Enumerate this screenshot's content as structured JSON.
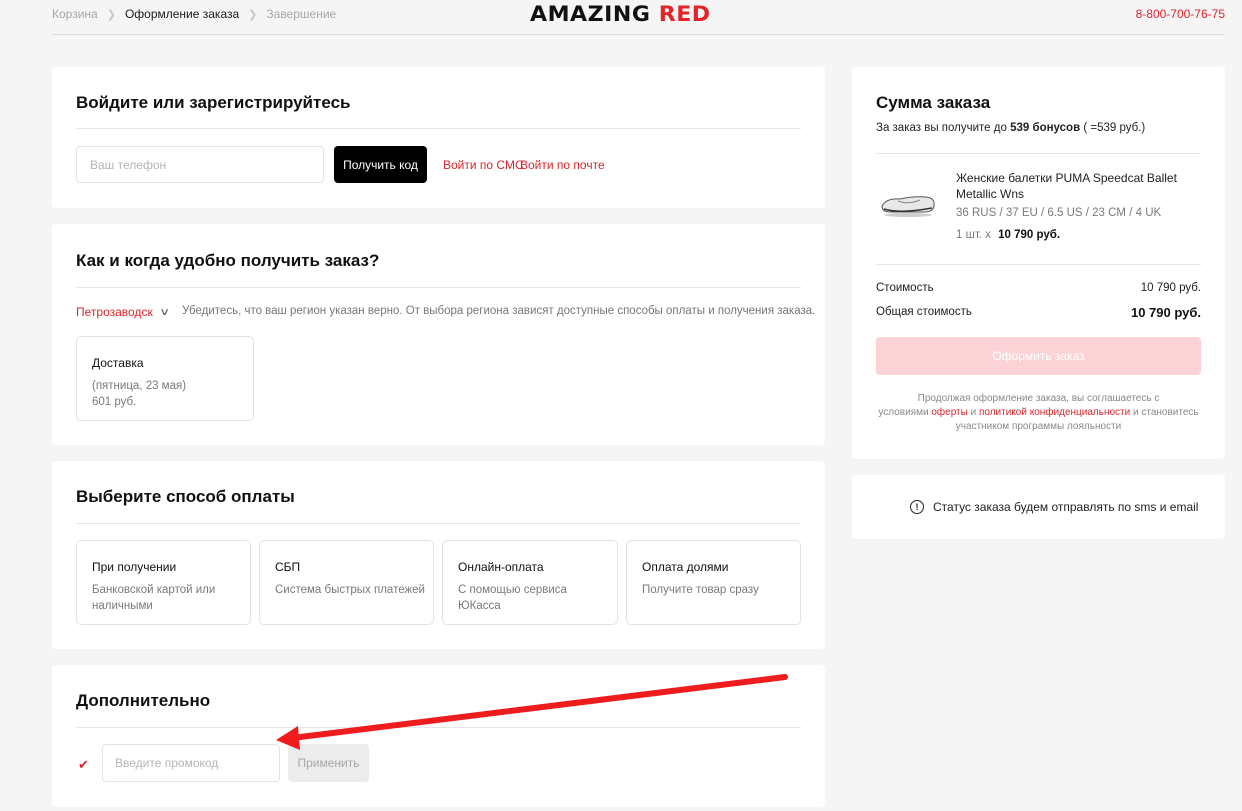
{
  "header": {
    "breadcrumbs": [
      "Корзина",
      "Оформление заказа",
      "Завершение"
    ],
    "logo_part1": "AMAZING",
    "logo_part2": "RED",
    "phone": "8-800-700-76-75"
  },
  "login": {
    "title": "Войдите или зарегистрируйтесь",
    "phone_placeholder": "Ваш телефон",
    "get_code_label": "Получить код",
    "sms_link": "Войти по СМС",
    "email_link": "Войти по почте"
  },
  "delivery": {
    "title": "Как и когда удобно получить заказ?",
    "region": "Петрозаводск",
    "region_note": "Убедитесь, что ваш регион указан верно. От выбора региона зависят доступные способы оплаты и получения заказа.",
    "option": {
      "title": "Доставка",
      "date": "(пятница, 23 мая)",
      "price": "601 руб."
    }
  },
  "payment": {
    "title": "Выберите способ оплаты",
    "options": [
      {
        "title": "При получении",
        "subtitle": "Банковской картой или наличными"
      },
      {
        "title": "СБП",
        "subtitle": "Система быстрых платежей"
      },
      {
        "title": "Онлайн-оплата",
        "subtitle": "С помощью сервиса ЮКасса"
      },
      {
        "title": "Оплата долями",
        "subtitle": "Получите товар сразу"
      }
    ]
  },
  "extra": {
    "title": "Дополнительно",
    "promo_placeholder": "Введите промокод",
    "apply_label": "Применить"
  },
  "summary": {
    "title": "Сумма заказа",
    "bonus_prefix": "За заказ вы получите до",
    "bonus_value": "539 бонусов",
    "bonus_suffix": "( =539 руб.)",
    "product": {
      "name": "Женские балетки PUMA Speedcat Ballet Metallic Wns",
      "size": "36 RUS / 37 EU / 6.5 US / 23 CM / 4 UK",
      "qty": "1 шт.  x",
      "price": "10 790 руб."
    },
    "cost_label": "Стоимость",
    "cost_value": "10 790 руб.",
    "total_label": "Общая стоимость",
    "total_value": "10 790 руб.",
    "checkout_label": "Оформить заказ",
    "terms_1": "Продолжая оформление заказа, вы соглашаетесь с",
    "terms_2": "условиями",
    "terms_offer": "оферты",
    "terms_and": "и",
    "terms_policy": "политикой конфиденциальности",
    "terms_3": "и становитесь",
    "terms_4": "участником программы лояльности"
  },
  "status": {
    "text": "Статус заказа будем отправлять по sms и email"
  },
  "colors": {
    "accent": "#e3242b",
    "checkout_disabled": "#fbd3d6",
    "annotation_arrow": "#ee1c1c"
  }
}
